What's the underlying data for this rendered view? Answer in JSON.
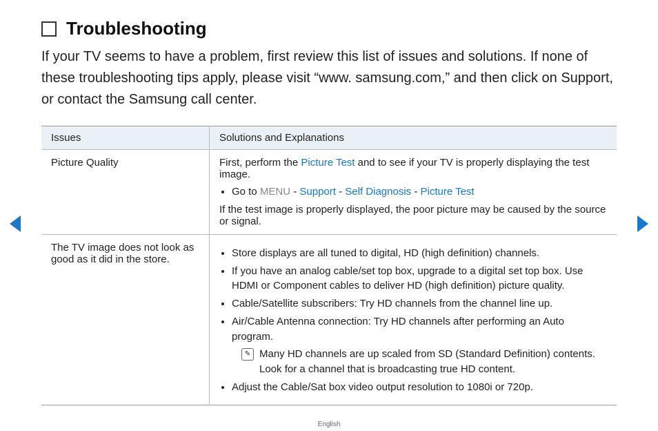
{
  "heading": "Troubleshooting",
  "intro": "If your TV seems to have a problem, first review this list of issues and solutions. If none of these troubleshooting tips apply, please visit “www. samsung.com,” and then click on Support, or contact the Samsung call center.",
  "table": {
    "headers": {
      "issues": "Issues",
      "solutions": "Solutions and Explanations"
    },
    "rows": [
      {
        "issue": "Picture Quality",
        "lead_before": "First, perform the ",
        "lead_link": "Picture Test",
        "lead_after": " and to see if your TV is properly displaying the test image.",
        "path": {
          "goto": "Go to ",
          "menu": "MENU",
          "sep": " - ",
          "support": "Support",
          "self_diag": "Self Diagnosis",
          "picture_test": "Picture Test"
        },
        "trail": "If the test image is properly displayed, the poor picture may be caused by the source or signal."
      },
      {
        "issue": "The TV image does not look as good as it did in the store.",
        "bullets": [
          "Store displays are all tuned to digital, HD (high definition) channels.",
          "If you have an analog cable/set top box, upgrade to a digital set top box. Use HDMI or Component cables to deliver HD (high definition) picture quality.",
          "Cable/Satellite subscribers: Try HD channels from the channel line up.",
          "Air/Cable Antenna connection: Try HD channels after performing an Auto program."
        ],
        "note": "Many HD channels are up scaled from SD (Standard Definition) contents. Look for a channel that is broadcasting true HD content.",
        "bullet_last": "Adjust the Cable/Sat box video output resolution to 1080i or 720p."
      }
    ]
  },
  "footer": {
    "language": "English"
  },
  "icons": {
    "note_glyph": "✎"
  }
}
